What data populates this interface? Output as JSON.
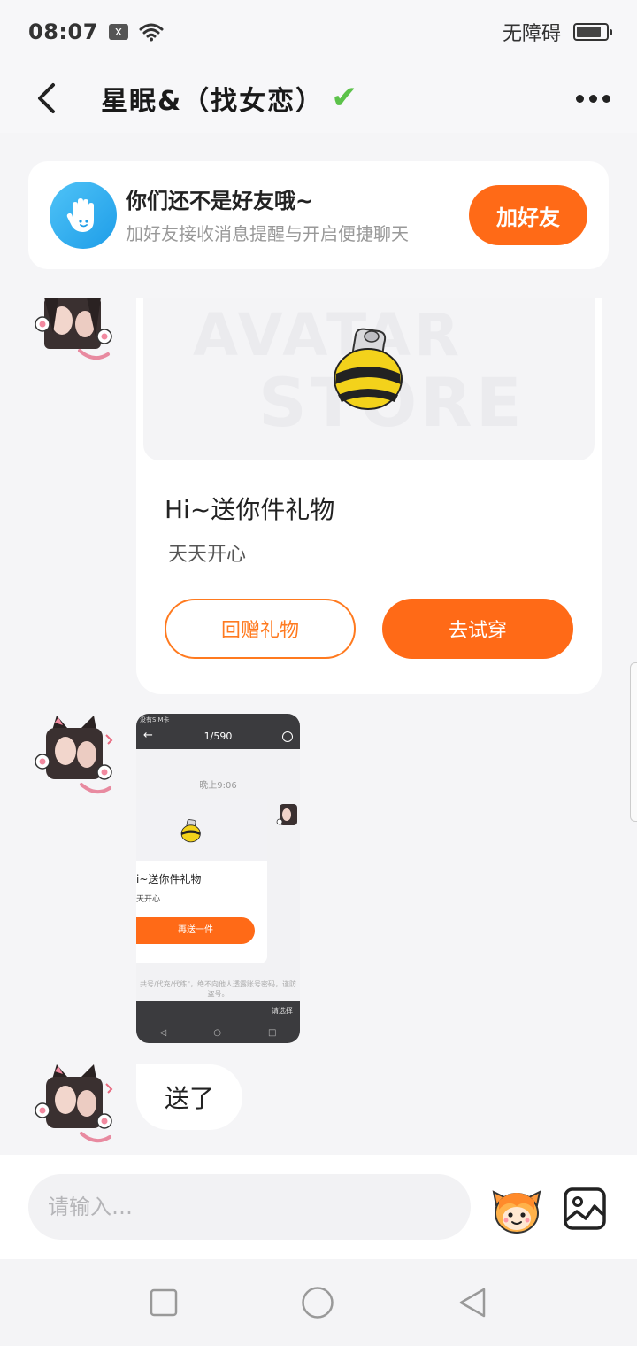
{
  "status_bar": {
    "time": "08:07",
    "sim_icon": "x",
    "wifi_icon": "wifi-icon",
    "accessibility": "无障碍",
    "battery_level": 0.85
  },
  "header": {
    "back_icon": "chevron-left-icon",
    "title": "星眠&（找女恋）",
    "verified_icon": "✔",
    "more_icon": "more-dots-icon"
  },
  "friend_banner": {
    "title": "你们还不是好友哦~",
    "subtitle": "加好友接收消息提醒与开启便捷聊天",
    "button": "加好友"
  },
  "gift_card": {
    "banner_watermark_1": "AVATAR",
    "banner_watermark_2": "STORE",
    "title": "Hi~送你件礼物",
    "subtitle": "天天开心",
    "return_button": "回赠礼物",
    "try_button": "去试穿"
  },
  "screenshot_message": {
    "status_text": "没有SIM卡",
    "page_indicator": "1/590",
    "time": "晚上9:06",
    "card_title": "i~送你件礼物",
    "card_subtitle": "天开心",
    "card_button": "再送一件",
    "note": "共号/代充/代练\"，绝不向他人透露账号密码，谨防盗号。",
    "select_label": "请选择"
  },
  "text_message": {
    "text": "送了"
  },
  "input_bar": {
    "placeholder": "请输入…"
  },
  "colors": {
    "accent": "#ff6a17",
    "verified": "#5cc24a",
    "wave": "#1e9de8"
  }
}
